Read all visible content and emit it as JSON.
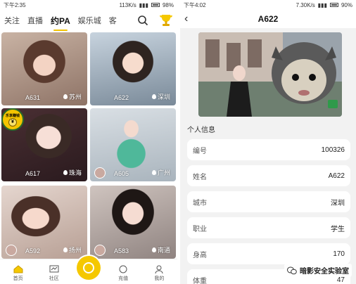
{
  "left": {
    "status": {
      "time": "下午2:35",
      "speed": "113K/s",
      "battery": "98%"
    },
    "tabs": [
      "关注",
      "直播",
      "约PA",
      "娱乐城",
      "客"
    ],
    "active_tab": 2,
    "cards": [
      {
        "name": "A631",
        "city": "苏州"
      },
      {
        "name": "A622",
        "city": "深圳"
      },
      {
        "name": "A617",
        "city": "珠海"
      },
      {
        "name": "A605",
        "city": "广州"
      },
      {
        "name": "A592",
        "city": "扬州"
      },
      {
        "name": "A583",
        "city": "南通"
      }
    ],
    "badge": {
      "top": "乐享赚钱",
      "coin": "¥"
    },
    "bottom_nav": [
      {
        "label": "首页"
      },
      {
        "label": "社区"
      },
      {
        "label": "充值"
      },
      {
        "label": "我的"
      }
    ]
  },
  "right": {
    "status": {
      "time": "下午4:02",
      "speed": "7.30K/s",
      "battery": "90%"
    },
    "title": "A622",
    "section_title": "个人信息",
    "info": [
      {
        "key": "编号",
        "value": "100326"
      },
      {
        "key": "姓名",
        "value": "A622"
      },
      {
        "key": "城市",
        "value": "深圳"
      },
      {
        "key": "职业",
        "value": "学生"
      },
      {
        "key": "身高",
        "value": "170"
      },
      {
        "key": "体重",
        "value": "47"
      }
    ],
    "watermark": "暗影安全实验室"
  },
  "colors": {
    "accent": "#f5c800",
    "bg": "#f2f2f2"
  }
}
